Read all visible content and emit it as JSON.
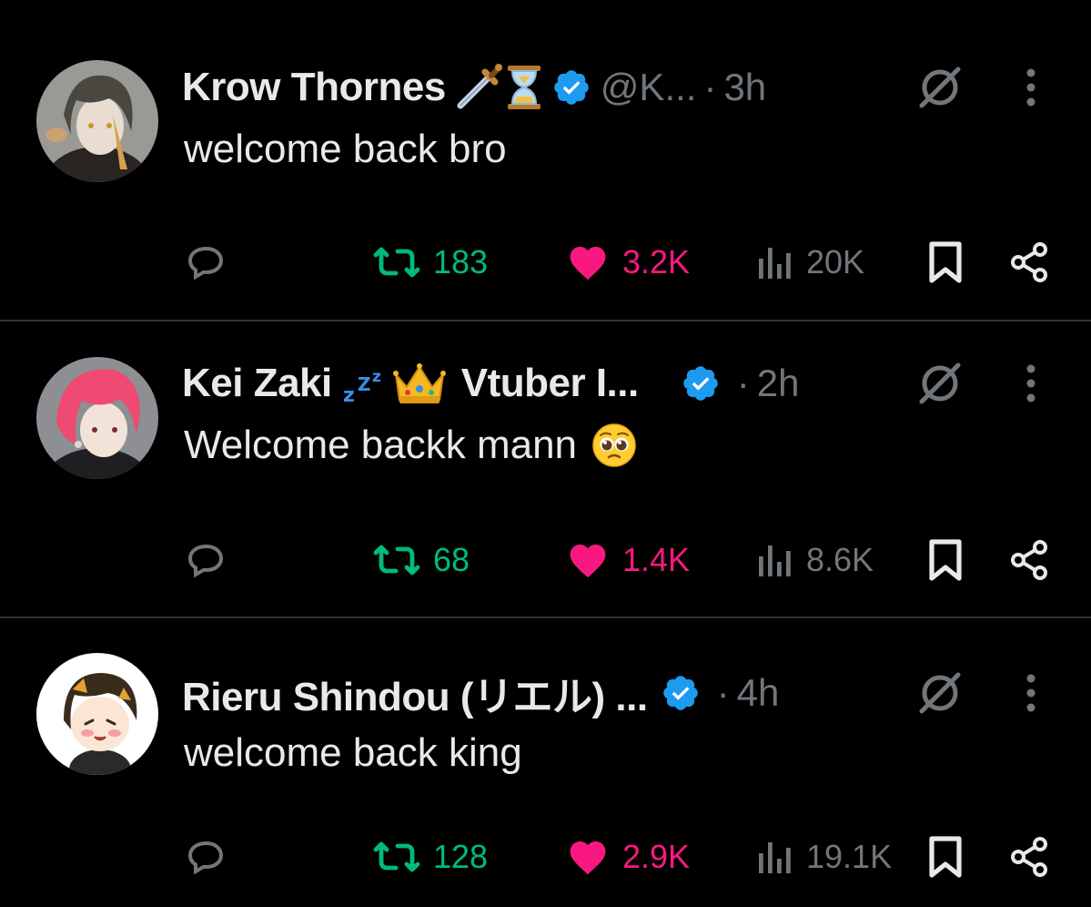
{
  "colors": {
    "background": "#000000",
    "text": "#e7e9ea",
    "muted": "#71767b",
    "repost": "#00ba7c",
    "like": "#f91880",
    "verified": "#1d9bf0",
    "divider": "#2f3336"
  },
  "posts": [
    {
      "display_name": "Krow Thornes",
      "emojis": [
        "dagger-emoji",
        "hourglass-emoji"
      ],
      "verified": true,
      "handle": "@K...",
      "separator": "·",
      "time": "3h",
      "text": "welcome back bro",
      "text_emoji": "",
      "replies": "",
      "reposts": "183",
      "likes": "3.2K",
      "views": "20K",
      "liked": true,
      "reposted": true
    },
    {
      "display_name": "Kei Zaki",
      "emojis": [
        "zzz-emoji",
        "crown-emoji"
      ],
      "name_suffix": "Vtuber I...",
      "verified": true,
      "handle": "",
      "separator": "·",
      "time": "2h",
      "text": "Welcome backk mann",
      "text_emoji": "pleading-face-emoji",
      "replies": "",
      "reposts": "68",
      "likes": "1.4K",
      "views": "8.6K",
      "liked": true,
      "reposted": true
    },
    {
      "display_name": "Rieru Shindou (リエル) ...",
      "emojis": [],
      "verified": true,
      "handle": "",
      "separator": "·",
      "time": "4h",
      "text": "welcome back king",
      "text_emoji": "",
      "replies": "",
      "reposts": "128",
      "likes": "2.9K",
      "views": "19.1K",
      "liked": true,
      "reposted": true
    }
  ]
}
